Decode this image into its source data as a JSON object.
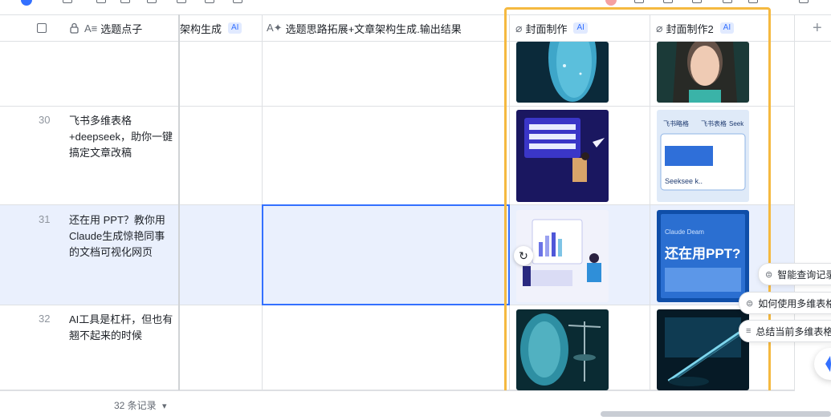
{
  "header": {
    "col_title_label": "选题点子",
    "col_structure_label": "架构生成",
    "col_expand_label": "选题思路拓展+文章架构生成.输出结果",
    "col_cover_label": "封面制作",
    "col_cover2_label": "封面制作2",
    "ai_badge": "AI"
  },
  "rows": [
    {
      "num": "",
      "title": ""
    },
    {
      "num": "30",
      "title": "飞书多维表格+deepseek，助你一键搞定文章改稿"
    },
    {
      "num": "31",
      "title": "还在用 PPT？教你用Claude生成惊艳同事的文档可视化网页"
    },
    {
      "num": "32",
      "title": "AI工具是杠杆，但也有翘不起来的时候"
    }
  ],
  "footer": {
    "record_count": "32 条记录",
    "dropdown": "▾"
  },
  "ai_suggestions": [
    {
      "label": "智能查询记录"
    },
    {
      "label": "如何使用多维表格"
    },
    {
      "label": "总结当前多维表格"
    }
  ],
  "thumb_texts": {
    "cover2_row30_a": "飞书略格",
    "cover2_row30_b": "飞书表格",
    "cover2_row30_c": "Seek",
    "cover2_row30_d": "Seeksee k..",
    "cover2_row31_a": "还在用PPT?",
    "cover2_row31_b": "Claude Deam"
  },
  "colors": {
    "accent": "#3370ff",
    "highlight": "#f5b940",
    "selected_row": "#eaf0fd"
  },
  "icons": [
    "lock-icon",
    "text-field-icon",
    "ai-text-icon",
    "attachment-icon",
    "plus-icon",
    "refresh-icon",
    "ai-assistant-icon"
  ]
}
